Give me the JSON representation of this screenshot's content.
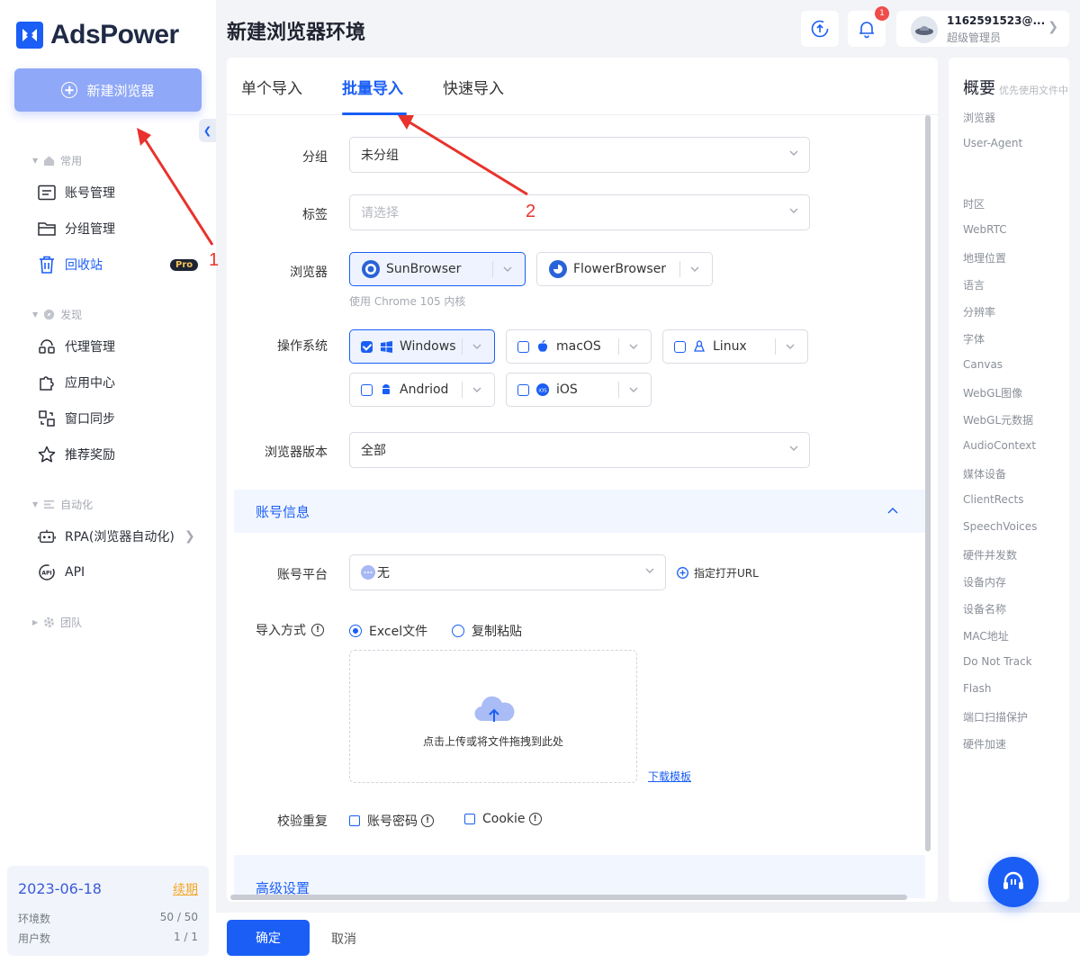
{
  "app": {
    "name": "AdsPower",
    "new_browser_label": "新建浏览器"
  },
  "sidebar": {
    "sections": [
      {
        "title": "常用"
      },
      {
        "title": "发现"
      },
      {
        "title": "自动化"
      },
      {
        "title": "团队"
      }
    ],
    "items": [
      {
        "label": "账号管理"
      },
      {
        "label": "分组管理"
      },
      {
        "label": "回收站",
        "badge": "Pro"
      },
      {
        "label": "代理管理"
      },
      {
        "label": "应用中心"
      },
      {
        "label": "窗口同步"
      },
      {
        "label": "推荐奖励"
      },
      {
        "label": "RPA(浏览器自动化)"
      },
      {
        "label": "API"
      }
    ],
    "subscription": {
      "date": "2023-06-18",
      "renew": "续期",
      "env_label": "环境数",
      "env_value": "50 / 50",
      "user_label": "用户数",
      "user_value": "1 / 1"
    }
  },
  "header": {
    "title": "新建浏览器环境",
    "notification_count": "1",
    "user_name": "1162591523@...",
    "user_role": "超级管理员"
  },
  "tabs": [
    {
      "label": "单个导入"
    },
    {
      "label": "批量导入",
      "active": true
    },
    {
      "label": "快速导入"
    }
  ],
  "form": {
    "group_label": "分组",
    "group_value": "未分组",
    "tag_label": "标签",
    "tag_placeholder": "请选择",
    "browser_label": "浏览器",
    "browsers": [
      {
        "name": "SunBrowser",
        "selected": true
      },
      {
        "name": "FlowerBrowser",
        "selected": false
      }
    ],
    "browser_hint": "使用 Chrome 105 内核",
    "os_label": "操作系统",
    "os_options": [
      {
        "name": "Windows",
        "checked": true
      },
      {
        "name": "macOS",
        "checked": false
      },
      {
        "name": "Linux",
        "checked": false
      },
      {
        "name": "Andriod",
        "checked": false
      },
      {
        "name": "iOS",
        "checked": false
      }
    ],
    "version_label": "浏览器版本",
    "version_value": "全部",
    "account_section": "账号信息",
    "platform_label": "账号平台",
    "platform_value": "无",
    "open_url": "指定打开URL",
    "import_label": "导入方式",
    "import_options": [
      {
        "label": "Excel文件",
        "selected": true
      },
      {
        "label": "复制粘贴",
        "selected": false
      }
    ],
    "upload_text": "点击上传或将文件拖拽到此处",
    "download_template": "下载模板",
    "dedupe_label": "校验重复",
    "dedupe_options": [
      "账号密码",
      "Cookie"
    ],
    "advanced_section": "高级设置"
  },
  "summary": {
    "title": "概要",
    "subtitle": "优先使用文件中",
    "items_top": [
      "浏览器",
      "User-Agent"
    ],
    "items": [
      "时区",
      "WebRTC",
      "地理位置",
      "语言",
      "分辨率",
      "字体",
      "Canvas",
      "WebGL图像",
      "WebGL元数据",
      "AudioContext",
      "媒体设备",
      "ClientRects",
      "SpeechVoices",
      "硬件并发数",
      "设备内存",
      "设备名称",
      "MAC地址",
      "Do Not Track",
      "Flash",
      "端口扫描保护",
      "硬件加速"
    ]
  },
  "footer": {
    "confirm": "确定",
    "cancel": "取消"
  },
  "annotations": [
    "1",
    "2"
  ],
  "colors": {
    "accent": "#1a5ef5",
    "annotation": "#e8322d",
    "renew": "#f5a623"
  }
}
